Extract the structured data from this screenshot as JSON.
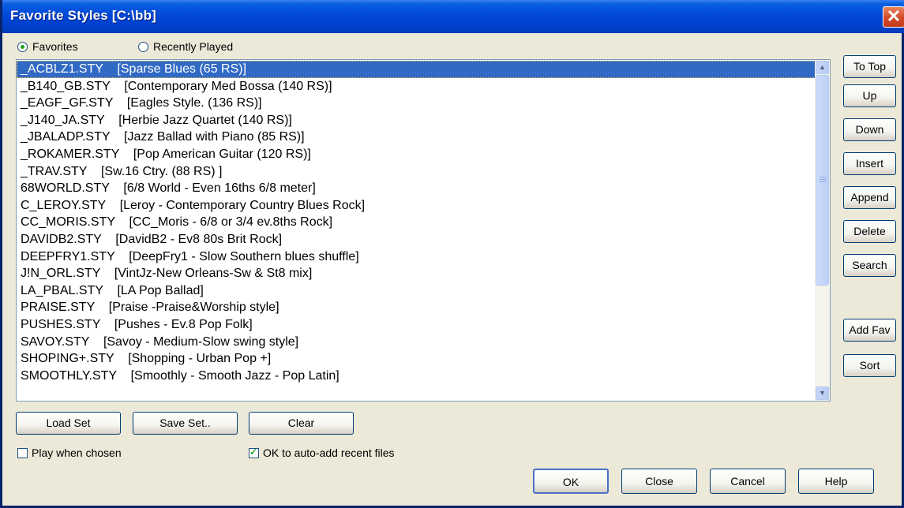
{
  "window": {
    "title": "Favorite Styles [C:\\bb]",
    "close_glyph": "✕"
  },
  "radios": {
    "favorites": {
      "label": "Favorites",
      "checked": true
    },
    "recent": {
      "label": "Recently Played",
      "checked": false
    }
  },
  "list": {
    "selected_index": 0,
    "items": [
      "_ACBLZ1.STY    [Sparse Blues (65 RS)]",
      "_B140_GB.STY    [Contemporary Med Bossa (140 RS)]",
      "_EAGF_GF.STY    [Eagles Style. (136 RS)]",
      "_J140_JA.STY    [Herbie Jazz Quartet (140 RS)]",
      "_JBALADP.STY    [Jazz Ballad with Piano (85 RS)]",
      "_ROKAMER.STY    [Pop American Guitar (120 RS)]",
      "_TRAV.STY    [Sw.16 Ctry. (88 RS) ]",
      "68WORLD.STY    [6/8 World - Even 16ths 6/8 meter]",
      "C_LEROY.STY    [Leroy - Contemporary Country Blues Rock]",
      "CC_MORIS.STY    [CC_Moris - 6/8 or 3/4 ev.8ths Rock]",
      "DAVIDB2.STY    [DavidB2 - Ev8 80s Brit Rock]",
      "DEEPFRY1.STY    [DeepFry1 - Slow Southern blues shuffle]",
      "J!N_ORL.STY    [VintJz-New Orleans-Sw & St8 mix]",
      "LA_PBAL.STY    [LA Pop Ballad]",
      "PRAISE.STY    [Praise -Praise&Worship style]",
      "PUSHES.STY    [Pushes - Ev.8 Pop Folk]",
      "SAVOY.STY    [Savoy - Medium-Slow swing style]",
      "SHOPING+.STY    [Shopping - Urban Pop +]",
      "SMOOTHLY.STY    [Smoothly - Smooth Jazz - Pop Latin]"
    ]
  },
  "side_buttons": [
    "To Top",
    "Up",
    "Down",
    "Insert",
    "Append",
    "Delete",
    "Search",
    "Add Fav",
    "Sort"
  ],
  "bottom_buttons": {
    "load": "Load Set",
    "save": "Save Set..",
    "clear": "Clear"
  },
  "checkboxes": {
    "play": {
      "label": "Play when chosen",
      "checked": false
    },
    "autoadd": {
      "label": "OK to auto-add recent files",
      "checked": true
    }
  },
  "dialog_buttons": {
    "ok": "OK",
    "close": "Close",
    "cancel": "Cancel",
    "help": "Help"
  },
  "colors": {
    "titlebar": "#0046d8",
    "selection": "#316ac5",
    "dialog_bg": "#ece9d8"
  }
}
